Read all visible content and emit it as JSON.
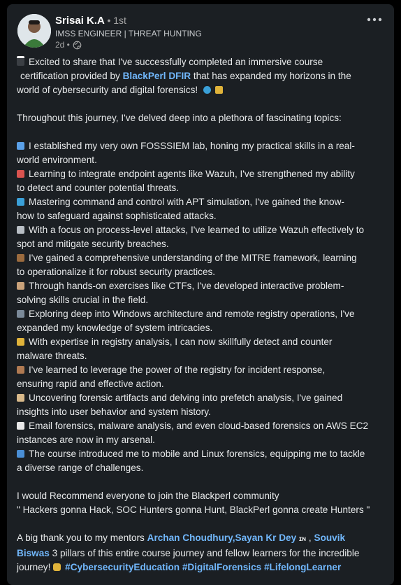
{
  "author": {
    "name": "Srisai K.A",
    "degree": "• 1st",
    "headline": "IMSS ENGINEER | THREAT HUNTING",
    "time": "2d •"
  },
  "post": {
    "intro_before": "Excited to share that I've successfully completed an immersive course",
    "intro_line2_before": "certification provided by ",
    "intro_link": "BlackPerl DFIR",
    "intro_line2_after": " that has expanded my horizons in the",
    "intro_line3": "world of cybersecurity and digital forensics!",
    "journey": "Throughout this journey, I've delved deep into a plethora of fascinating topics:",
    "items": [
      {
        "icon": "magnifier-icon",
        "color": "#5aa0e8",
        "line1": "I established my very own FOSSSIEM lab, honing my practical skills in a real-",
        "line2": "world environment."
      },
      {
        "icon": "shield-icon",
        "color": "#d9534f",
        "line1": "Learning to integrate endpoint agents like Wazuh, I've strengthened my ability",
        "line2": "to detect and counter potential threats."
      },
      {
        "icon": "globe-icon",
        "color": "#3aa0d8",
        "line1": "Mastering command and control with APT simulation, I've gained the know-",
        "line2": "how to safeguard against sophisticated attacks."
      },
      {
        "icon": "gear-icon",
        "color": "#b8bec4",
        "line1": "With a focus on process-level attacks, I've learned to utilize Wazuh effectively to",
        "line2": "spot and mitigate security breaches."
      },
      {
        "icon": "briefcase-icon",
        "color": "#9b6b3e",
        "line1": "I've gained a comprehensive understanding of the MITRE framework, learning",
        "line2": "to operationalize it for robust security practices."
      },
      {
        "icon": "detective-icon",
        "color": "#c9a27a",
        "line1": "Through hands-on exercises like CTFs, I've developed interactive problem-",
        "line2": "solving skills crucial in the field."
      },
      {
        "icon": "computer-icon",
        "color": "#7b8a99",
        "line1": "Exploring deep into Windows architecture and remote registry operations, I've",
        "line2": "expanded my knowledge of system intricacies."
      },
      {
        "icon": "key-icon",
        "color": "#e0b33a",
        "line1": "With expertise in registry analysis, I can now skillfully detect and counter",
        "line2": "malware threats."
      },
      {
        "icon": "book-icon",
        "color": "#b07a52",
        "line1": "I've learned to leverage the power of the registry for incident response,",
        "line2": "ensuring rapid and effective action."
      },
      {
        "icon": "scroll-icon",
        "color": "#d8b98a",
        "line1": "Uncovering forensic artifacts and delving into prefetch analysis, I've gained",
        "line2": "insights into user behavior and system history."
      },
      {
        "icon": "envelope-icon",
        "color": "#e8e8e8",
        "line1": "Email forensics, malware analysis, and even cloud-based forensics on AWS EC2",
        "line2": "instances are now in my arsenal."
      },
      {
        "icon": "phone-icon",
        "color": "#4a8fd6",
        "line1": "The course introduced me to mobile and Linux forensics, equipping me to tackle",
        "line2": "a diverse range of challenges."
      }
    ],
    "recommend": "I would Recommend everyone to join the Blackperl community",
    "quote": "\" Hackers gonna Hack, SOC Hunters gonna Hunt, BlackPerl gonna create Hunters \"",
    "thanks_before": "A big thank you to my mentors ",
    "mentor1": "Archan Choudhury",
    "comma1": ",",
    "mentor2": "Sayan Kr Dey",
    "mentor2_badge": "ɪɴ",
    "comma2": " , ",
    "mentor3a": "Souvik",
    "mentor3b": "Biswas",
    "thanks_after": " 3 pillars of this entire course journey and fellow learners for the incredible",
    "journey_word": "journey!",
    "hashtag1": "#CybersecurityEducation",
    "hashtag2": "#DigitalForensics",
    "hashtag3": "#LifelongLearner"
  },
  "colors": {
    "card": "#1b1f23",
    "link": "#71b7fb",
    "text": "#e7e9ea"
  }
}
